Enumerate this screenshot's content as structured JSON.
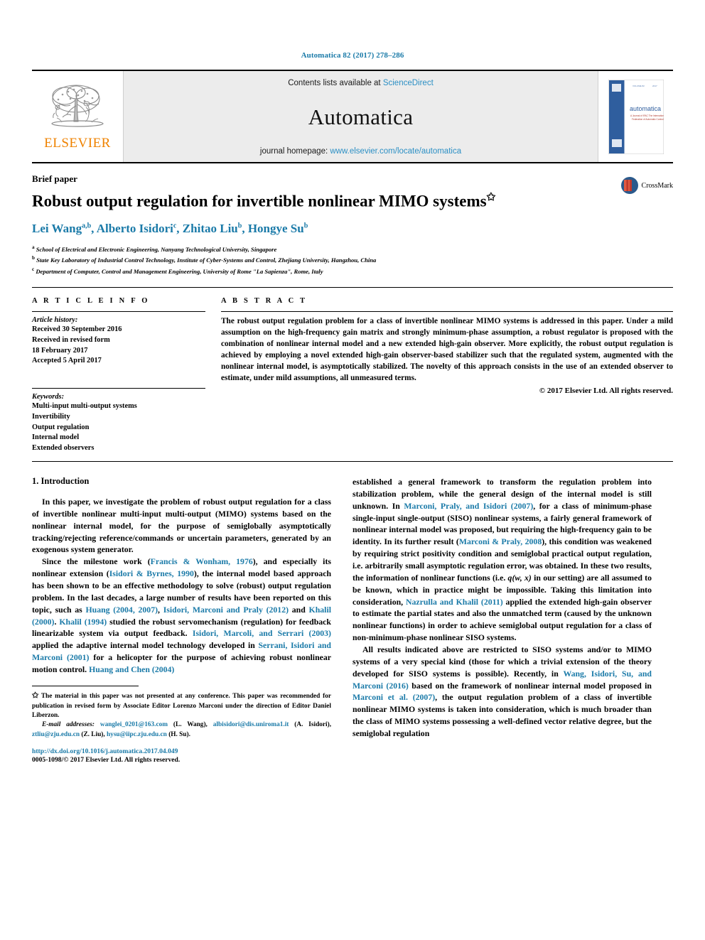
{
  "journal_ref": "Automatica 82 (2017) 278–286",
  "masthead": {
    "elsevier_wordmark": "ELSEVIER",
    "contents_prefix": "Contents lists available at ",
    "contents_link": "ScienceDirect",
    "journal_name": "Automatica",
    "homepage_prefix": "journal homepage: ",
    "homepage_link": "www.elsevier.com/locate/automatica",
    "cover_title": "automatica",
    "cover_subtitle": "A Journal of IFAC The International Federation of Automatic Control",
    "cover_badge": "IFAC"
  },
  "article": {
    "type_label": "Brief paper",
    "title": "Robust output regulation for invertible nonlinear MIMO systems",
    "title_star": "✩",
    "crossmark_label": "CrossMark",
    "authors_html": "Lei Wang<sup>a,b</sup>, Alberto Isidori<sup>c</sup>, Zhitao Liu<sup>b</sup>, Hongye Su<sup>b</sup>",
    "affiliations": [
      {
        "mark": "a",
        "text": "School of Electrical and Electronic Engineering, Nanyang Technological University, Singapore"
      },
      {
        "mark": "b",
        "text": "State Key Laboratory of Industrial Control Technology, Institute of Cyber-Systems and Control, Zhejiang University, Hangzhou, China"
      },
      {
        "mark": "c",
        "text": "Department of Computer, Control and Management Engineering, University of Rome \"La Sapienza\", Rome, Italy"
      }
    ]
  },
  "info": {
    "heading": "A R T I C L E    I N F O",
    "history_title": "Article history:",
    "history": [
      "Received 30 September 2016",
      "Received in revised form",
      "18 February 2017",
      "Accepted 5 April 2017"
    ],
    "keywords_title": "Keywords:",
    "keywords": [
      "Multi-input multi-output systems",
      "Invertibility",
      "Output regulation",
      "Internal model",
      "Extended observers"
    ]
  },
  "abstract": {
    "heading": "A B S T R A C T",
    "text": "The robust output regulation problem for a class of invertible nonlinear MIMO systems is addressed in this paper. Under a mild assumption on the high-frequency gain matrix and strongly minimum-phase assumption, a robust regulator is proposed with the combination of nonlinear internal model and a new extended high-gain observer. More explicitly, the robust output regulation is achieved by employing a novel extended high-gain observer-based stabilizer such that the regulated system, augmented with the nonlinear internal model, is asymptotically stabilized. The novelty of this approach consists in the use of an extended observer to estimate, under mild assumptions, all unmeasured terms.",
    "copyright": "© 2017 Elsevier Ltd. All rights reserved."
  },
  "intro": {
    "heading": "1. Introduction",
    "p1": "In this paper, we investigate the problem of robust output regulation for a class of invertible nonlinear multi-input multi-output (MIMO) systems based on the nonlinear internal model, for the purpose of semiglobally asymptotically tracking/rejecting reference/commands or uncertain parameters, generated by an exogenous system generator."
  },
  "footnote": {
    "star": "✩",
    "text": "The material in this paper was not presented at any conference. This paper was recommended for publication in revised form by Associate Editor Lorenzo Marconi under the direction of Editor Daniel Liberzon.",
    "email_label": "E-mail addresses:",
    "emails": [
      {
        "address": "wanglei_0201@163.com",
        "owner": "(L. Wang),"
      },
      {
        "address": "albisidori@dis.uniroma1.it",
        "owner": "(A. Isidori),"
      },
      {
        "address": "ztliu@zju.edu.cn",
        "owner": "(Z. Liu),"
      },
      {
        "address": "hysu@iipc.zju.edu.cn",
        "owner": "(H. Su)."
      }
    ],
    "doi": "http://dx.doi.org/10.1016/j.automatica.2017.04.049",
    "issn": "0005-1098/© 2017 Elsevier Ltd. All rights reserved."
  },
  "colors": {
    "link_blue": "#1a7aa8",
    "sd_blue": "#2b8fc4",
    "elsevier_orange": "#ef8200",
    "cover_blue": "#2f5e9e"
  }
}
